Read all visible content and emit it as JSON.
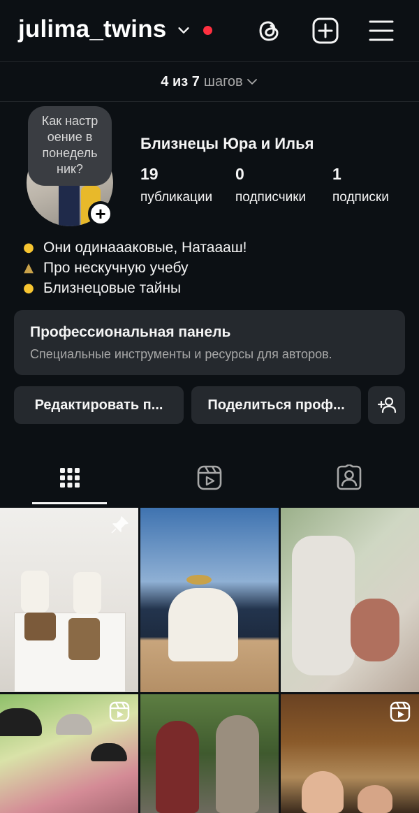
{
  "header": {
    "username": "julima_twins",
    "icons": [
      "chevron-down-icon",
      "threads-icon",
      "create-icon",
      "menu-icon"
    ],
    "notification_dot_color": "#ff3040"
  },
  "steps": {
    "progress": "4 из 7",
    "label": "шагов"
  },
  "profile": {
    "note": "Как настр оение в понедель ник?",
    "display_name": "Близнецы Юра и Илья",
    "stats": [
      {
        "value": "19",
        "label": "публикации"
      },
      {
        "value": "0",
        "label": "подписчики"
      },
      {
        "value": "1",
        "label": "подписки"
      }
    ],
    "bio": [
      {
        "icon": "grinning-face-icon",
        "glyph": "☺",
        "text": "Они одинаааковые, Натаааш!"
      },
      {
        "icon": "graduation-cap-icon",
        "glyph": "🎓",
        "text": "Про нескучную учебу"
      },
      {
        "icon": "winking-tongue-face-icon",
        "glyph": "☻",
        "text": "Близнецовые тайны"
      }
    ]
  },
  "pro_dashboard": {
    "title": "Профессиональная панель",
    "subtitle": "Специальные инструменты и ресурсы для авторов."
  },
  "actions": {
    "edit_label": "Редактировать п...",
    "share_label": "Поделиться проф...",
    "discover_icon": "add-person-icon"
  },
  "tabs": [
    {
      "name": "posts-grid",
      "icon": "grid-icon",
      "active": true
    },
    {
      "name": "reels",
      "icon": "reels-icon",
      "active": false
    },
    {
      "name": "tagged",
      "icon": "tagged-icon",
      "active": false
    }
  ],
  "posts": [
    {
      "kind": "photo",
      "badge": "pin-icon",
      "colors": [
        "#ecebe8",
        "#cfcac2",
        "#8a6a46"
      ]
    },
    {
      "kind": "photo",
      "badge": "",
      "colors": [
        "#5f86b8",
        "#2a3f5c",
        "#caa87e"
      ]
    },
    {
      "kind": "photo",
      "badge": "",
      "colors": [
        "#8fa37c",
        "#d9d3c8",
        "#a76a5a"
      ]
    },
    {
      "kind": "reel",
      "badge": "reels-icon",
      "colors": [
        "#7fae5c",
        "#cf7f8a",
        "#3c4a2c"
      ]
    },
    {
      "kind": "photo",
      "badge": "",
      "colors": [
        "#4f6a3c",
        "#7a2a2a",
        "#8a7b6a"
      ]
    },
    {
      "kind": "reel",
      "badge": "reels-icon",
      "colors": [
        "#8a5a2a",
        "#c9a06a",
        "#3a2a1c"
      ]
    }
  ],
  "colors": {
    "background": "#0c1014",
    "surface": "#25292e",
    "text": "#f5f5f5",
    "secondary_text": "#a8a8a8"
  }
}
